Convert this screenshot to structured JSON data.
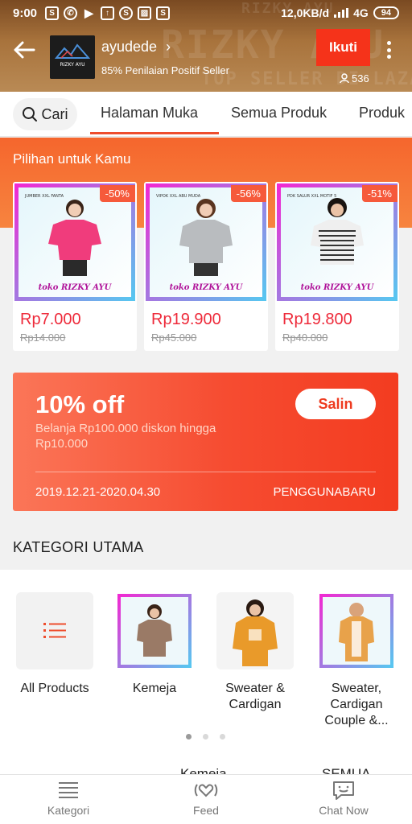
{
  "status_bar": {
    "time": "9:00",
    "network_speed": "12,0KB/d",
    "network_type": "4G",
    "battery": "94",
    "notification_icons": [
      "shopee-bag-icon",
      "whatsapp-icon",
      "play-store-icon",
      "upload-icon",
      "shopee-s-icon",
      "gallery-icon",
      "shopee-bag-icon"
    ]
  },
  "header": {
    "shop_name": "ayudede",
    "rating_text": "85% Penilaian Positif Seller",
    "follow_label": "Ikuti",
    "followers": "536",
    "watermark_1": "RIZKY AYU",
    "watermark_2": "TOP SELLER DI LAZADA",
    "logo_text": "RIZKY AYU"
  },
  "tabs": {
    "search_label": "Cari",
    "items": [
      "Halaman Muka",
      "Semua Produk",
      "Produk"
    ],
    "active": "Halaman Muka"
  },
  "picks": {
    "title": "Pilihan untuk Kamu",
    "products": [
      {
        "discount": "-50%",
        "price": "Rp7.000",
        "old_price": "Rp14.000",
        "caption": "toko RIZKY AYU",
        "tag": "JUMBER XXL FANTA",
        "shirt_color": "#f03c7c"
      },
      {
        "discount": "-56%",
        "price": "Rp19.900",
        "old_price": "Rp45.000",
        "caption": "toko RIZKY AYU",
        "tag": "VIPOK XXL ABU MUDA",
        "shirt_color": "#b9bcbf"
      },
      {
        "discount": "-51%",
        "price": "Rp19.800",
        "old_price": "Rp40.000",
        "caption": "toko RIZKY AYU",
        "tag": "PDK SALUR XXL MOTIF 5",
        "shirt_color": "#7a7a7a"
      }
    ]
  },
  "voucher": {
    "title": "10% off",
    "description": "Belanja Rp100.000 diskon hingga Rp10.000",
    "copy_label": "Salin",
    "date_range": "2019.12.21-2020.04.30",
    "code": "PENGGUNABARU"
  },
  "categories": {
    "heading": "KATEGORI UTAMA",
    "items": [
      {
        "label": "All Products",
        "icon": "list-icon"
      },
      {
        "label": "Kemeja",
        "icon": "product-thumb"
      },
      {
        "label": "Sweater & Cardigan",
        "icon": "product-thumb"
      },
      {
        "label": "Sweater, Cardigan Couple &...",
        "icon": "product-thumb"
      }
    ],
    "pagination": {
      "total": 3,
      "active": 1
    }
  },
  "next_section": {
    "title": "Kemeja",
    "see_all": "SEMUA"
  },
  "bottom_nav": {
    "items": [
      {
        "label": "Kategori",
        "icon": "menu-lines-icon"
      },
      {
        "label": "Feed",
        "icon": "feed-heart-icon"
      },
      {
        "label": "Chat Now",
        "icon": "chat-icon"
      }
    ]
  },
  "colors": {
    "accent": "#ee4d2d",
    "follow_button": "#f5331a",
    "price": "#ee2a3a",
    "header_bg": "#a8733c"
  }
}
